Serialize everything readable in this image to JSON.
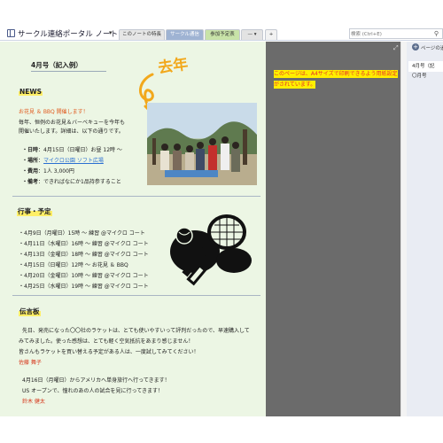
{
  "app": {
    "notebook_title": "サークル連絡ポータル ノート",
    "tabs": [
      {
        "label": "このノートの特長"
      },
      {
        "label": "サークル通信"
      },
      {
        "label": "参加予定表"
      },
      {
        "label": "— ▾"
      }
    ],
    "add_tab": "+",
    "search_placeholder": "検索 (Ctrl+E)"
  },
  "colors": {
    "page_background": "#ecf6e4",
    "overflow_area": "#6b6b6b",
    "highlight": "#ffef00",
    "accent_orange": "#e05a1e",
    "author_red": "#d6381c",
    "link_blue": "#2a6fd1"
  },
  "page": {
    "title": "4月号（記入例）",
    "overlay_text": "去年",
    "note": "このページは、A4サイズで印刷できるよう用紙設定がされています。",
    "news": {
      "heading": "NEWS",
      "subtitle": "お花見 ＆ BBQ 開催します！",
      "intro": [
        "毎年、恒例のお花見＆バーベキューを今年も",
        "開催いたします。詳細は、以下の通りです。"
      ],
      "details": [
        {
          "label": "・日時",
          "value": "4月15日（日曜日）お昼 12時 〜"
        },
        {
          "label": "・場所",
          "value": "マイクロ公園 ソフト広場",
          "link": true
        },
        {
          "label": "・費用",
          "value": "1人 3,000円"
        },
        {
          "label": "・備考",
          "value": "できればなにか1品持参すること"
        }
      ]
    },
    "schedule": {
      "heading": "行事・予定",
      "items": [
        "・4月9日（月曜日）15時 〜 練習 @マイクロ コート",
        "・4月11日（水曜日）16時 〜 練習 @マイクロ コート",
        "・4月13日（金曜日）18時 〜 練習 @マイクロ コート",
        "・4月15日（日曜日）12時 〜 お花見 ＆ BBQ",
        "・4月20日（金曜日）10時 〜 練習 @マイクロ コート",
        "・4月25日（水曜日）19時 〜 練習 @マイクロ コート"
      ]
    },
    "messages": {
      "heading": "伝言板",
      "entries": [
        {
          "lines": [
            "先日、発売になった〇〇社のラケットは、とても使いやすいって評判だったので、早速購入して",
            "みてみました。使った感想は、とても軽く空気抵抗をあまり感じません！",
            "皆さんもラケットを買い替える予定がある人は、一度試してみてください！"
          ],
          "author": "佐藤 舞子"
        },
        {
          "lines": [
            "4月16日（月曜日）からアメリカへ単身旅行へ行ってきます！",
            "US オープンで、憧れのあの人の試合を見に行ってきます！"
          ],
          "author": "鈴木 健太"
        }
      ]
    }
  },
  "page_list": {
    "add_page": "ページの追加",
    "entries": [
      "4月号（記",
      "〇月号"
    ]
  }
}
